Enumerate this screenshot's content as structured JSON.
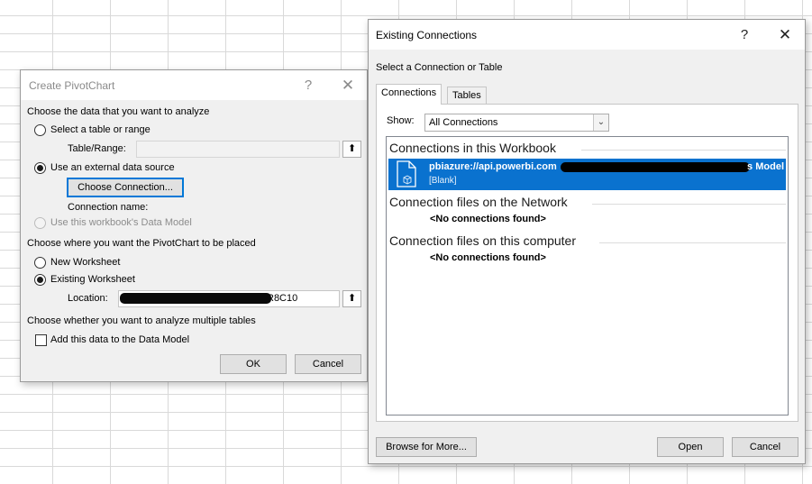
{
  "pivot_dialog": {
    "title": "Create PivotChart",
    "help_glyph": "?",
    "close_glyph": "✕",
    "section1_heading": "Choose the data that you want to analyze",
    "option_table_range": "Select a table or range",
    "table_range_label": "Table/Range:",
    "table_range_value": "",
    "option_external": "Use an external data source",
    "choose_connection_button": "Choose Connection...",
    "connection_name_label": "Connection name:",
    "option_data_model": "Use this workbook's Data Model",
    "section2_heading": "Choose where you want the PivotChart to be placed",
    "option_new_worksheet": "New Worksheet",
    "option_existing_worksheet": "Existing Worksheet",
    "location_label": "Location:",
    "location_value_visible": "R8C10",
    "section3_heading": "Choose whether you want to analyze multiple tables",
    "add_to_data_model": "Add this data to the Data Model",
    "ok_button": "OK",
    "cancel_button": "Cancel",
    "collapse_glyph": "⬆"
  },
  "connections_dialog": {
    "title": "Existing Connections",
    "help_glyph": "?",
    "close_glyph": "✕",
    "select_label": "Select a Connection or Table",
    "tabs": [
      {
        "label": "Connections",
        "active": true
      },
      {
        "label": "Tables",
        "active": false
      }
    ],
    "show_label": "Show:",
    "show_value": "All Connections",
    "show_arrow": "⌄",
    "sections": [
      {
        "heading": "Connections in this Workbook"
      },
      {
        "heading": "Connection files on the Network",
        "empty_text": "<No connections found>"
      },
      {
        "heading": "Connection files on this computer",
        "empty_text": "<No connections found>"
      }
    ],
    "selected_connection": {
      "name": "pbiazure://api.powerbi.com",
      "name_suffix": "s Model",
      "description": "[Blank]"
    },
    "browse_button": "Browse for More...",
    "open_button": "Open",
    "cancel_button": "Cancel"
  },
  "colors": {
    "selection": "#0a72cf",
    "focus_border": "#0078d7",
    "dialog_bg": "#f0f0f0",
    "gridline": "#d9d9d9"
  }
}
